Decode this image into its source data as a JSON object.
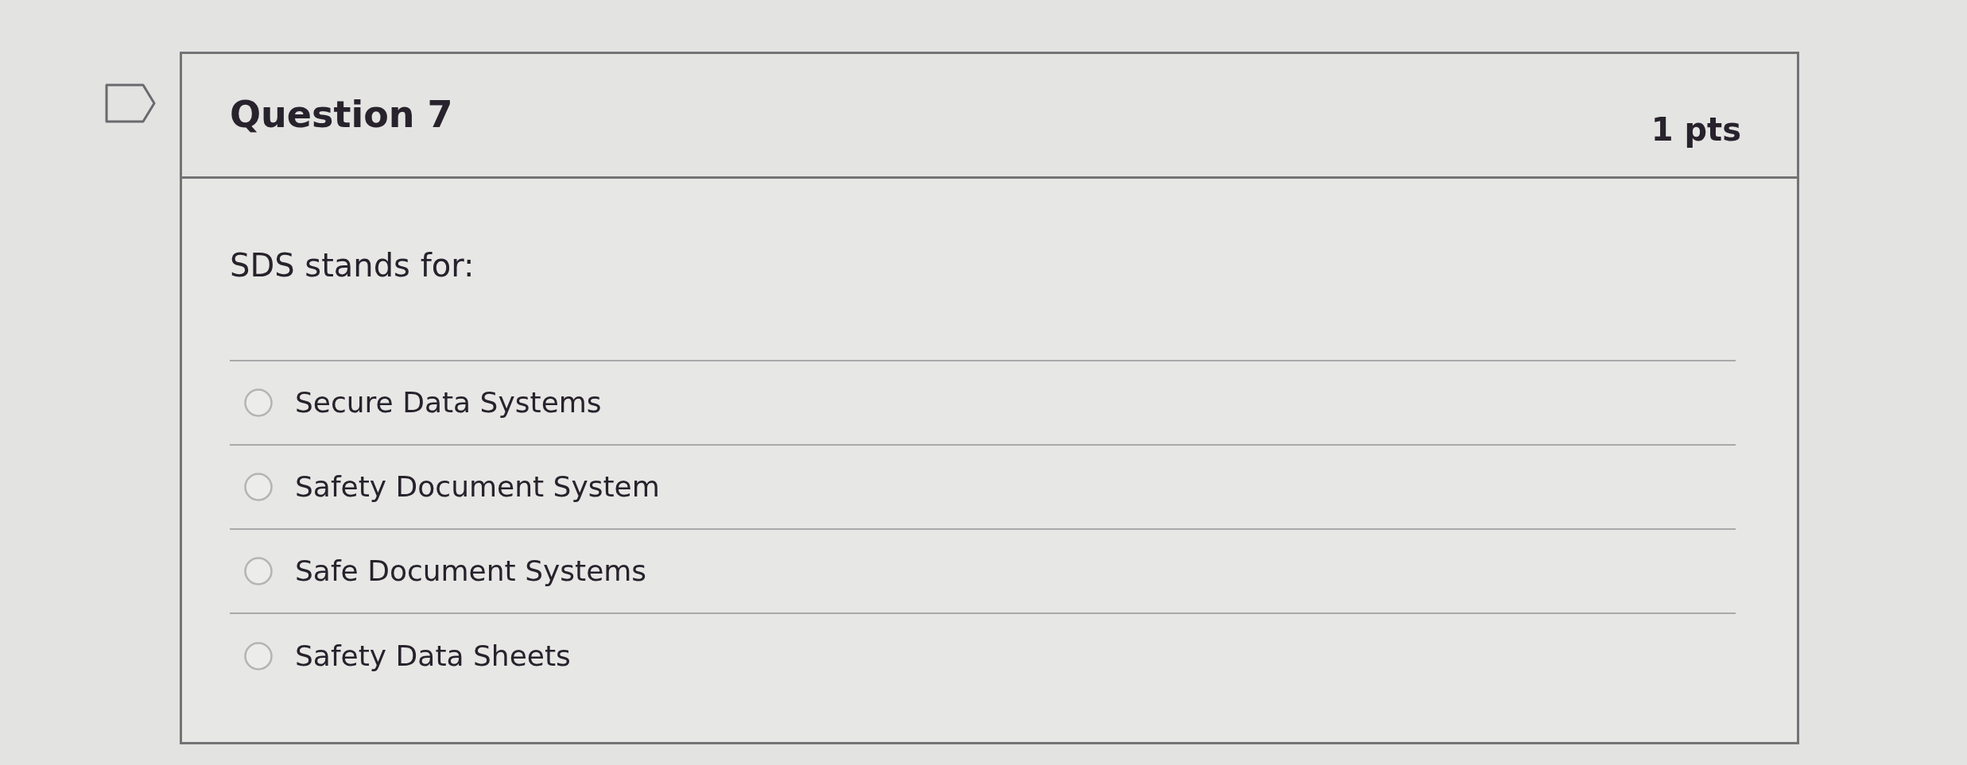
{
  "question": {
    "flagged": false,
    "title": "Question 7",
    "points": "1 pts",
    "prompt": "SDS stands for:",
    "options": [
      {
        "label": "Secure Data Systems",
        "selected": false
      },
      {
        "label": "Safety Document System",
        "selected": false
      },
      {
        "label": "Safe Document Systems",
        "selected": false
      },
      {
        "label": "Safety Data Sheets",
        "selected": false
      }
    ]
  }
}
